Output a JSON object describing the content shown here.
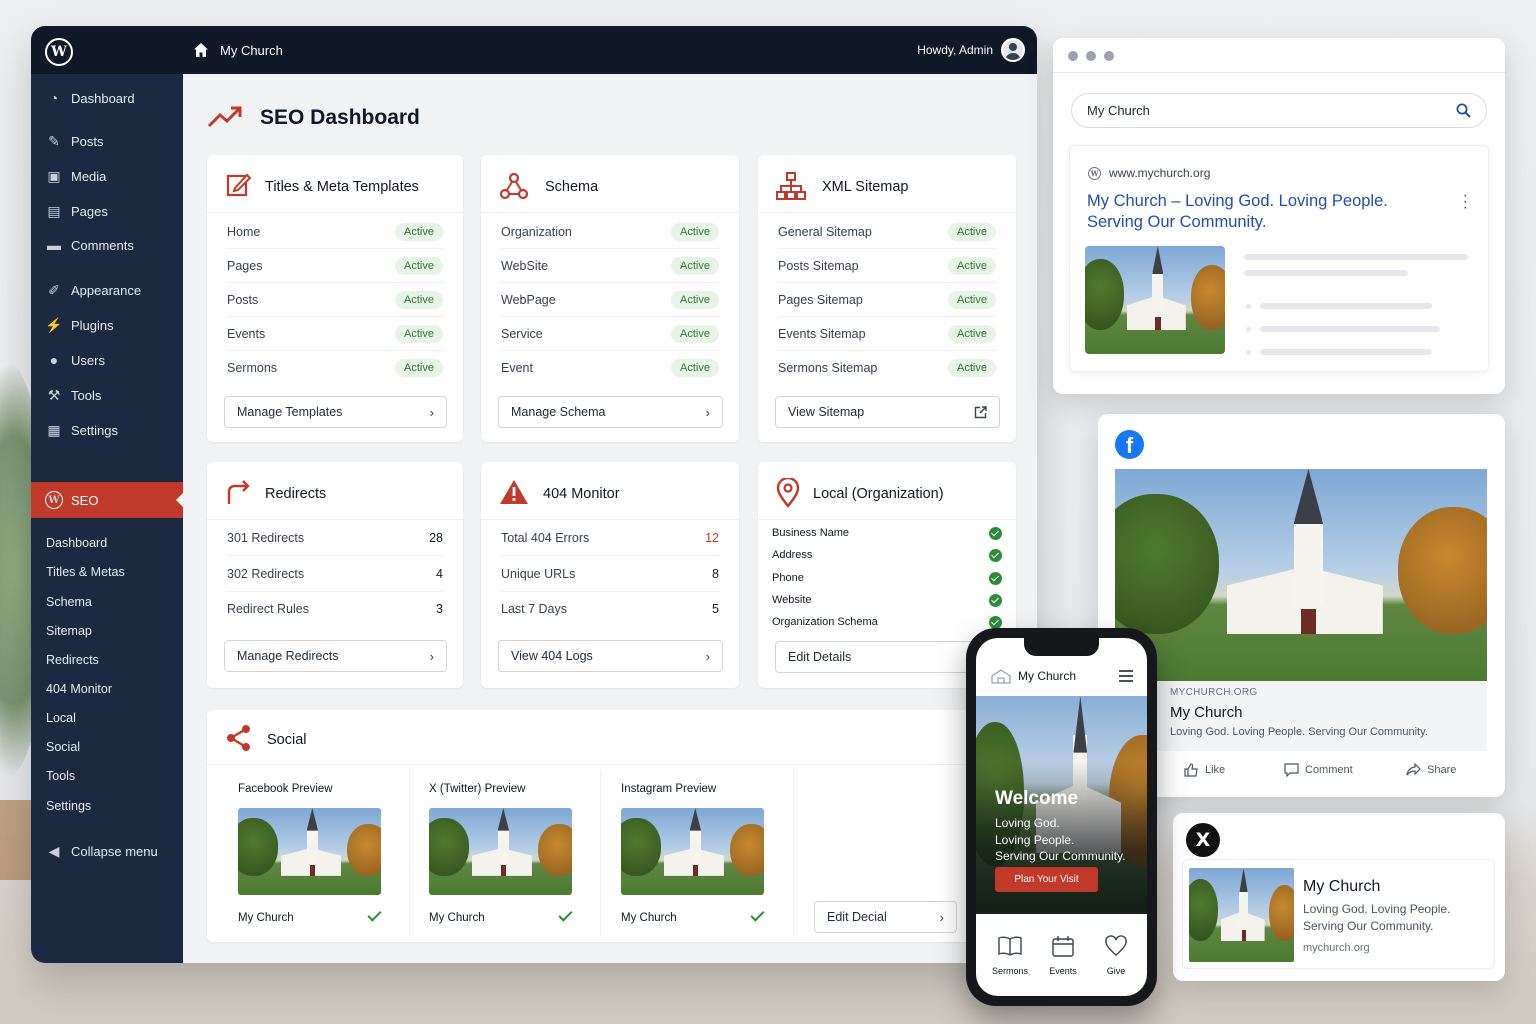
{
  "topbar": {
    "site_name": "My Church",
    "greeting": "Howdy, Admin"
  },
  "sidebar": {
    "items": [
      {
        "label": "Dashboard",
        "icon": "dashboard-icon"
      },
      {
        "label": "Posts",
        "icon": "pin-icon"
      },
      {
        "label": "Media",
        "icon": "media-icon"
      },
      {
        "label": "Pages",
        "icon": "pages-icon"
      },
      {
        "label": "Comments",
        "icon": "comments-icon"
      },
      {
        "label": "Appearance",
        "icon": "brush-icon"
      },
      {
        "label": "Plugins",
        "icon": "plugin-icon"
      },
      {
        "label": "Users",
        "icon": "user-icon"
      },
      {
        "label": "Tools",
        "icon": "wrench-icon"
      },
      {
        "label": "Settings",
        "icon": "settings-icon"
      }
    ],
    "seo_label": "SEO",
    "submenu": [
      "Dashboard",
      "Titles & Metas",
      "Schema",
      "Sitemap",
      "Redirects",
      "404 Monitor",
      "Local",
      "Social",
      "Tools",
      "Settings"
    ],
    "collapse": "Collapse menu"
  },
  "page": {
    "title": "SEO Dashboard"
  },
  "cards": {
    "titles": {
      "title": "Titles & Meta Templates",
      "rows": [
        {
          "label": "Home",
          "status": "Active"
        },
        {
          "label": "Pages",
          "status": "Active"
        },
        {
          "label": "Posts",
          "status": "Active"
        },
        {
          "label": "Events",
          "status": "Active"
        },
        {
          "label": "Sermons",
          "status": "Active"
        }
      ],
      "button": "Manage Templates"
    },
    "schema": {
      "title": "Schema",
      "rows": [
        {
          "label": "Organization",
          "status": "Active"
        },
        {
          "label": "WebSite",
          "status": "Active"
        },
        {
          "label": "WebPage",
          "status": "Active"
        },
        {
          "label": "Service",
          "status": "Active"
        },
        {
          "label": "Event",
          "status": "Active"
        }
      ],
      "button": "Manage Schema"
    },
    "sitemap": {
      "title": "XML Sitemap",
      "rows": [
        {
          "label": "General Sitemap",
          "status": "Active"
        },
        {
          "label": "Posts Sitemap",
          "status": "Active"
        },
        {
          "label": "Pages Sitemap",
          "status": "Active"
        },
        {
          "label": "Events Sitemap",
          "status": "Active"
        },
        {
          "label": "Sermons Sitemap",
          "status": "Active"
        }
      ],
      "button": "View Sitemap"
    },
    "redirects": {
      "title": "Redirects",
      "rows": [
        {
          "label": "301 Redirects",
          "value": "28"
        },
        {
          "label": "302 Redirects",
          "value": "4"
        },
        {
          "label": "Redirect Rules",
          "value": "3"
        }
      ],
      "button": "Manage Redirects"
    },
    "monitor": {
      "title": "404 Monitor",
      "rows": [
        {
          "label": "Total 404 Errors",
          "value": "12"
        },
        {
          "label": "Unique URLs",
          "value": "8"
        },
        {
          "label": "Last 7 Days",
          "value": "5"
        }
      ],
      "button": "View 404 Logs"
    },
    "local": {
      "title": "Local (Organization)",
      "rows": [
        "Business Name",
        "Address",
        "Phone",
        "Website",
        "Organization Schema"
      ],
      "button": "Edit Details"
    },
    "social": {
      "title": "Social",
      "previews": [
        {
          "heading": "Facebook Preview",
          "name": "My Church"
        },
        {
          "heading": "X (Twitter) Preview",
          "name": "My Church"
        },
        {
          "heading": "Instagram Preview",
          "name": "My Church"
        }
      ],
      "button": "Edit Decial"
    }
  },
  "search_preview": {
    "query": "My Church",
    "url": "www.mychurch.org",
    "title": "My Church – Loving God. Loving People. Serving Our Community."
  },
  "facebook_preview": {
    "domain": "MYCHURCH.ORG",
    "title": "My Church",
    "description": "Loving God. Loving People. Serving Our Community.",
    "actions": [
      "Like",
      "Comment",
      "Share"
    ]
  },
  "x_preview": {
    "logo": "X",
    "title": "My Church",
    "description": "Loving God. Loving People. Serving Our Community.",
    "domain": "mychurch.org"
  },
  "phone": {
    "site_name": "My Church",
    "welcome": "Welcome",
    "tagline_lines": [
      "Loving God.",
      "Loving People.",
      "Serving Our Community."
    ],
    "cta": "Plan Your Visit",
    "nav": [
      "Sermons",
      "Events",
      "Give"
    ]
  },
  "colors": {
    "accent": "#c0392b",
    "sidebar": "#1b2a41",
    "topbar": "#111827",
    "active_badge": "#2f7d32",
    "link": "#1f4fa8",
    "facebook": "#1877f2"
  }
}
